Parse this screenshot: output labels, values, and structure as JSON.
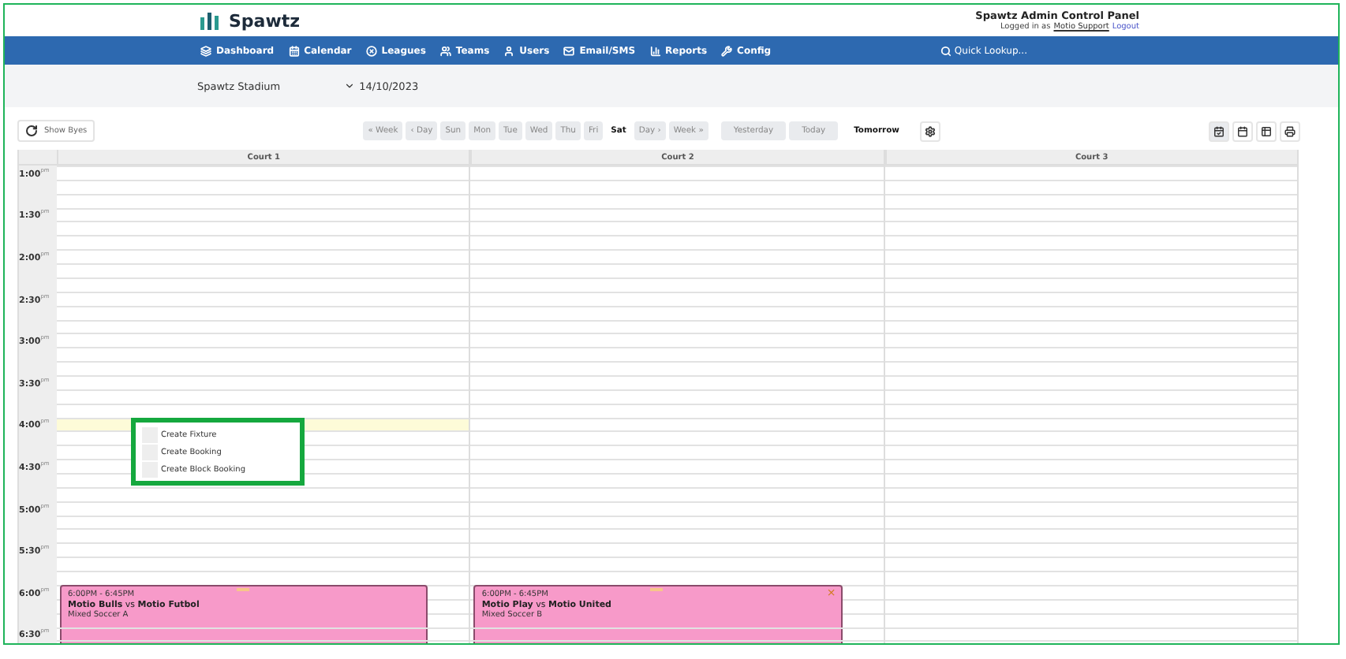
{
  "header": {
    "brand": "Spawtz",
    "panel_title": "Spawtz Admin Control Panel",
    "logged_in": "Logged in as",
    "user": "Motio Support",
    "logout": "Logout"
  },
  "nav": [
    {
      "label": "Dashboard"
    },
    {
      "label": "Calendar"
    },
    {
      "label": "Leagues"
    },
    {
      "label": "Teams"
    },
    {
      "label": "Users"
    },
    {
      "label": "Email/SMS"
    },
    {
      "label": "Reports"
    },
    {
      "label": "Config"
    }
  ],
  "quick_lookup": "Quick Lookup...",
  "venue": "Spawtz Stadium",
  "date": "14/10/2023",
  "show_byes": "Show Byes",
  "day_nav": [
    {
      "label": "« Week",
      "selected": false
    },
    {
      "label": "‹ Day",
      "selected": false
    },
    {
      "label": "Sun",
      "selected": false
    },
    {
      "label": "Mon",
      "selected": false
    },
    {
      "label": "Tue",
      "selected": false
    },
    {
      "label": "Wed",
      "selected": false
    },
    {
      "label": "Thu",
      "selected": false
    },
    {
      "label": "Fri",
      "selected": false
    },
    {
      "label": "Sat",
      "selected": true
    },
    {
      "label": "Day ›",
      "selected": false
    },
    {
      "label": "Week »",
      "selected": false
    }
  ],
  "relative_nav": [
    {
      "label": "Yesterday",
      "selected": false
    },
    {
      "label": "Today",
      "selected": false
    },
    {
      "label": "Tomorrow",
      "selected": true
    }
  ],
  "views": [
    {
      "selected": true
    },
    {
      "selected": false
    },
    {
      "selected": false
    },
    {
      "selected": false
    }
  ],
  "courts": [
    {
      "name": "Court 1",
      "bookings": [
        {
          "time": "6:00PM - 6:45PM",
          "title": "**Motio Bulls** vs **Motio Futbol**",
          "league": "Mixed Soccer A"
        }
      ]
    },
    {
      "name": "Court 2",
      "bookings": [
        {
          "time": "6:00PM - 6:45PM",
          "title": "**Motio Play** vs **Motio United**",
          "league": "Mixed Soccer B",
          "close": "×"
        }
      ]
    },
    {
      "name": "Court 3"
    }
  ],
  "times": [
    {
      "label": "1:00$^{pm}$",
      "selected": false
    },
    {
      "label": "1:30$^{pm}$",
      "selected": false
    },
    {
      "label": "2:00$^{pm}$",
      "selected": false
    },
    {
      "label": "2:30$^{pm}$",
      "selected": false
    },
    {
      "label": "3:00$^{pm}$",
      "selected": false
    },
    {
      "label": "3:30$^{pm}$",
      "selected": false
    },
    {
      "label": "4:00$^{pm}$",
      "selected": true
    },
    {
      "label": "4:30$^{pm}$",
      "selected": false
    },
    {
      "label": "5:00$^{pm}$",
      "selected": false
    },
    {
      "label": "5:30$^{pm}$",
      "selected": false
    },
    {
      "label": "6:00$^{pm}$",
      "selected": false
    },
    {
      "label": "6:30$^{pm}$",
      "selected": false
    }
  ],
  "context_menu": [
    "Create Fixture",
    "Create Booking",
    "Create Block Booking"
  ]
}
